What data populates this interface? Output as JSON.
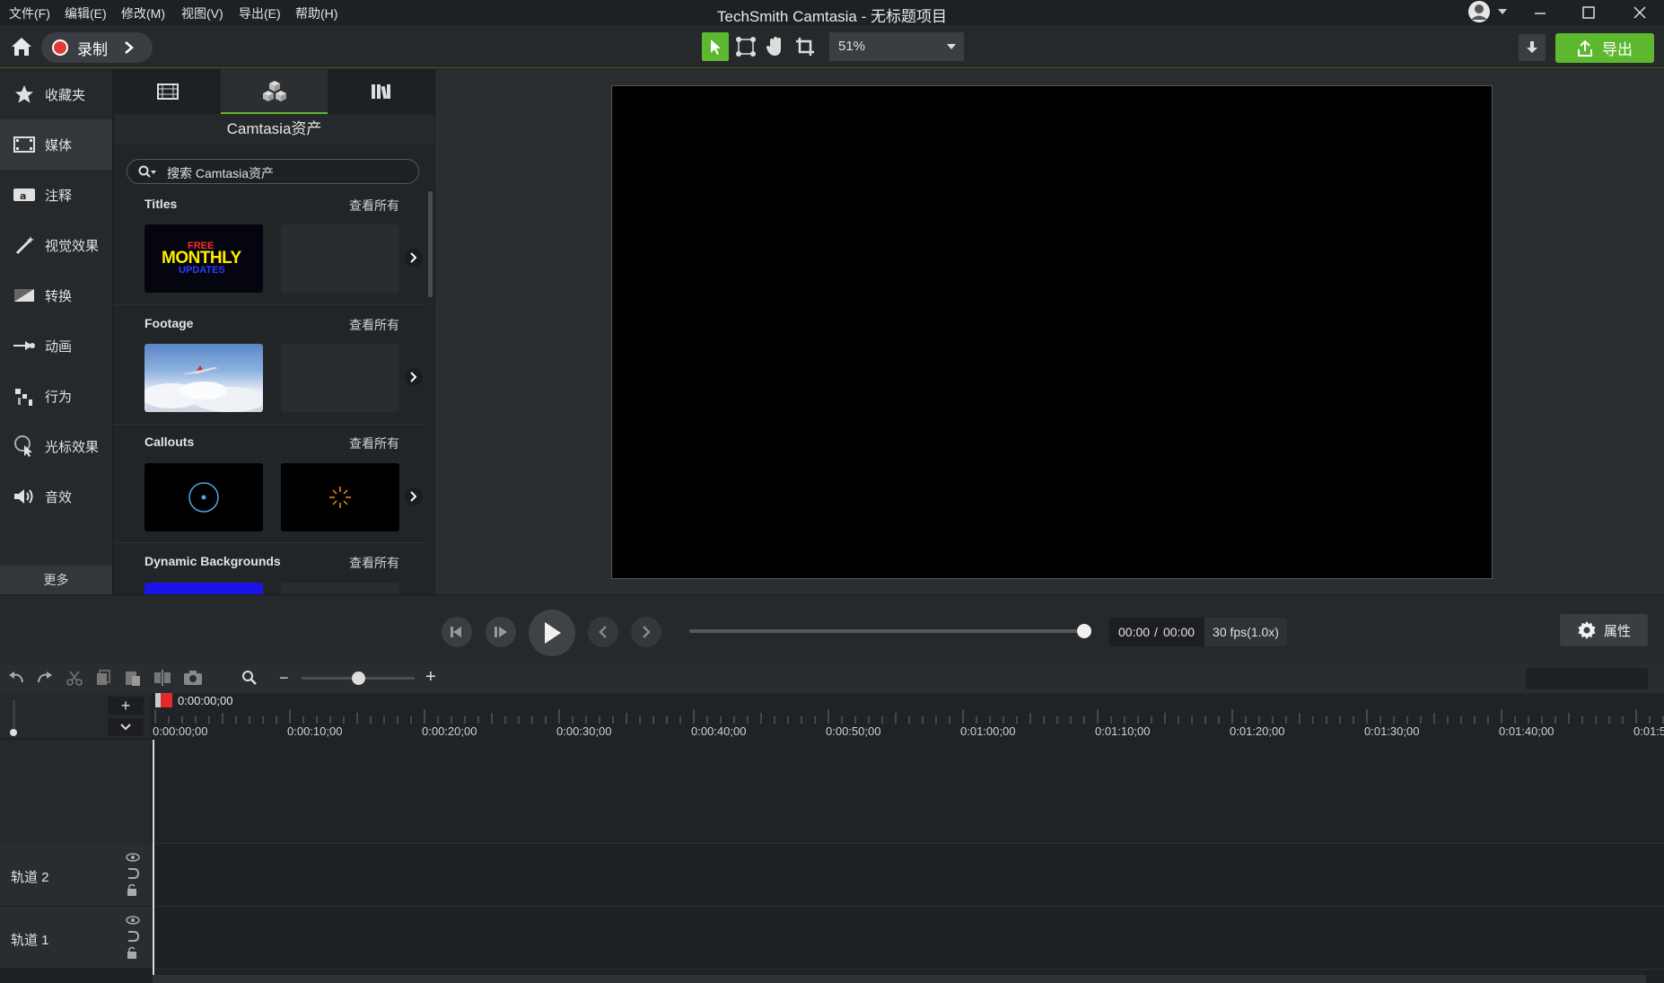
{
  "app_title": "TechSmith Camtasia - 无标题项目",
  "menu": [
    "文件(F)",
    "编辑(E)",
    "修改(M)",
    "视图(V)",
    "导出(E)",
    "帮助(H)"
  ],
  "toolbar": {
    "record_label": "录制",
    "zoom_value": "51%",
    "export_label": "导出"
  },
  "nav": {
    "items": [
      {
        "label": "收藏夹",
        "icon": "star-icon"
      },
      {
        "label": "媒体",
        "icon": "film-icon"
      },
      {
        "label": "注释",
        "icon": "annotation-icon"
      },
      {
        "label": "视觉效果",
        "icon": "magic-wand-icon"
      },
      {
        "label": "转换",
        "icon": "transition-icon"
      },
      {
        "label": "动画",
        "icon": "animation-icon"
      },
      {
        "label": "行为",
        "icon": "behavior-icon"
      },
      {
        "label": "光标效果",
        "icon": "cursor-effect-icon"
      },
      {
        "label": "音效",
        "icon": "speaker-icon"
      }
    ],
    "more_label": "更多",
    "active_index": 1
  },
  "library": {
    "header": "Camtasia资产",
    "search_placeholder": "搜索 Camtasia资产",
    "sections": [
      {
        "title": "Titles",
        "see_all": "查看所有",
        "thumb_text_1": "FREE",
        "thumb_text_2": "MONTHLY",
        "thumb_text_3": "UPDATES"
      },
      {
        "title": "Footage",
        "see_all": "查看所有"
      },
      {
        "title": "Callouts",
        "see_all": "查看所有"
      },
      {
        "title": "Dynamic Backgrounds",
        "see_all": "查看所有"
      }
    ]
  },
  "playback": {
    "time_current": "00:00",
    "time_separator": "/",
    "time_total": "00:00",
    "fps": "30 fps(1.0x)",
    "properties_label": "属性",
    "scrubber_position": 1.0
  },
  "timeline": {
    "playhead_time": "0:00:00;00",
    "ruler_labels": [
      "0:00:00;00",
      "0:00:10;00",
      "0:00:20;00",
      "0:00:30;00",
      "0:00:40;00",
      "0:00:50;00",
      "0:01:00;00",
      "0:01:10;00",
      "0:01:20;00",
      "0:01:30;00",
      "0:01:40;00",
      "0:01:5"
    ],
    "zoom_level": 0.5,
    "tracks": [
      {
        "label": "轨道 2"
      },
      {
        "label": "轨道 1"
      }
    ]
  },
  "colors": {
    "accent_green": "#5cb82e",
    "record_red": "#e53935"
  }
}
